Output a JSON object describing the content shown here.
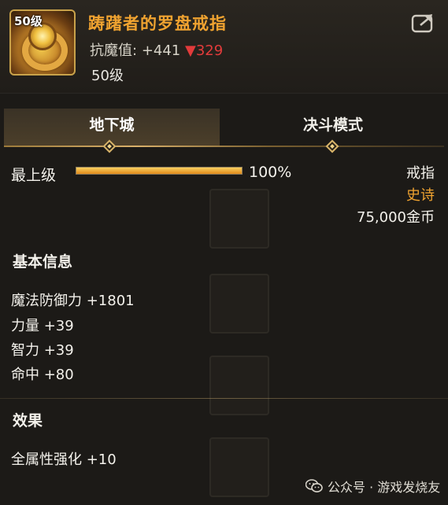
{
  "item": {
    "title": "踌躇者的罗盘戒指",
    "icon_level": "50级",
    "stat_label": "抗魔值:",
    "stat_value": "+441",
    "stat_change": "▼329",
    "level": "50级"
  },
  "tabs": [
    {
      "label": "地下城",
      "active": true
    },
    {
      "label": "决斗模式",
      "active": false
    }
  ],
  "progress": {
    "label": "最上级",
    "percent_text": "100%",
    "fraction": 1.0
  },
  "meta": {
    "type": "戒指",
    "rarity": "史诗",
    "price": "75,000金币"
  },
  "basic_info": {
    "title": "基本信息",
    "attributes": [
      "魔法防御力 +1801",
      "力量 +39",
      "智力 +39",
      "命中 +80"
    ]
  },
  "effects": {
    "title": "效果",
    "lines": [
      "全属性强化 +10"
    ]
  },
  "watermark": "公众号 · 游戏发烧友",
  "icons": {
    "share": "share-icon",
    "watermark": "wechat-icon"
  },
  "colors": {
    "title": "#f0a330",
    "rarity": "#f0a330",
    "down": "#e23b3b",
    "accent_gold": "#d9b06a"
  }
}
